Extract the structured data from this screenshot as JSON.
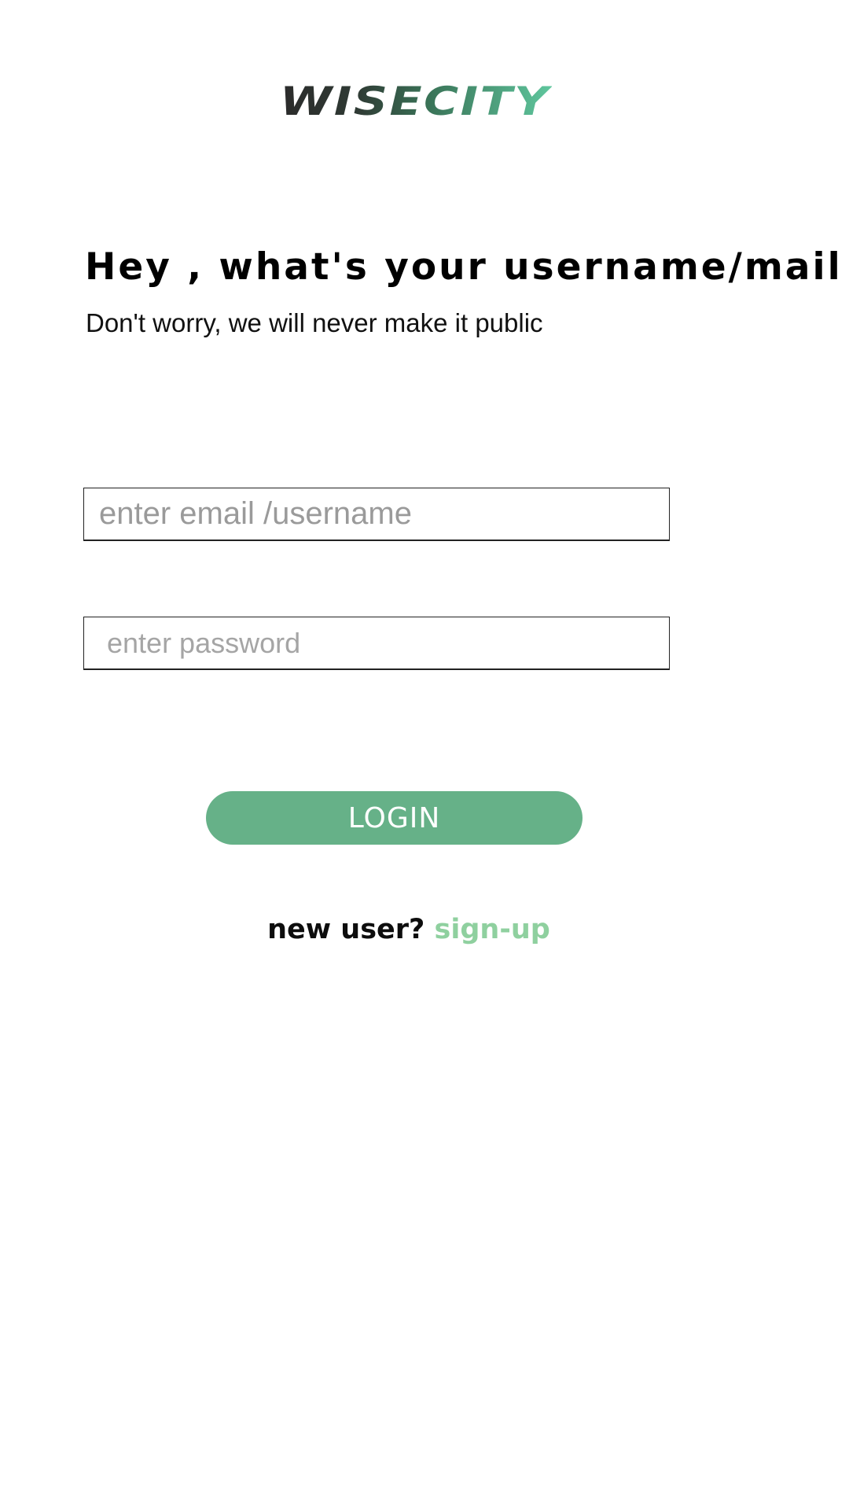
{
  "brand": {
    "logo_text": "WISECITY",
    "colors": {
      "dark": "#2b2b2b",
      "mid": "#3a7458",
      "light": "#5fc79e"
    }
  },
  "header": {
    "title": "Hey , what's your username/mail ?",
    "subtitle": "Don't worry, we will never make it public"
  },
  "form": {
    "email_placeholder": "enter email /username",
    "email_value": "",
    "password_placeholder": "enter password",
    "password_value": "",
    "login_label": "LOGIN"
  },
  "signup": {
    "prompt": "new user? ",
    "link_label": "sign-up"
  },
  "colors": {
    "accent": "#66b188",
    "link": "#8fd09f",
    "text": "#000000"
  }
}
